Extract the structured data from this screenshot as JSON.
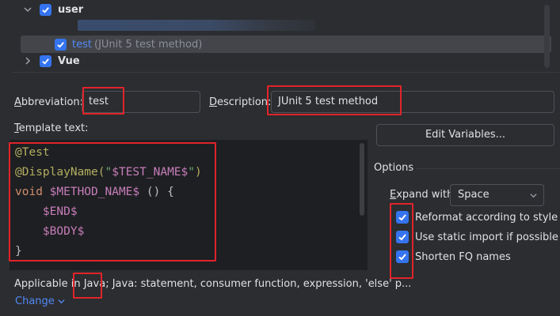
{
  "tree": {
    "items": [
      {
        "label": "user",
        "checked": true,
        "expanded": true
      },
      {
        "label": "test",
        "description": "(JUnit 5 test method)",
        "checked": true,
        "selected": true
      },
      {
        "label": "Vue",
        "checked": true,
        "expanded": false
      }
    ]
  },
  "form": {
    "abbreviation_label_u": "A",
    "abbreviation_label_rest": "bbreviation:",
    "abbreviation_value": "test",
    "description_label_u": "D",
    "description_label_rest": "escription:",
    "description_value": "JUnit 5 test method",
    "template_label_u": "T",
    "template_label_rest": "emplate text:",
    "edit_variables_label": "Edit Variables..."
  },
  "template_code": {
    "line1": "@Test",
    "line2_ann": "@DisplayName(",
    "line2_str_open": "\"",
    "line2_var": "$TEST_NAME$",
    "line2_str_close": "\"",
    "line2_end": ")",
    "line3_kw": "void ",
    "line3_var": "$METHOD_NAME$",
    "line3_rest": " () {",
    "line4_var": "$END$",
    "line5_var": "$BODY$",
    "line6": "}"
  },
  "options": {
    "title": "Options",
    "expand_with_label_u": "E",
    "expand_with_label_rest": "xpand with",
    "expand_with_value": "Space",
    "checkboxes": [
      {
        "label": "Reformat according to style",
        "checked": true
      },
      {
        "label": "Use static import if possible",
        "checked": true
      },
      {
        "label": "Shorten FQ names",
        "checked": true
      }
    ]
  },
  "applicable": {
    "prefix": "Applicable in ",
    "java": "Java",
    "rest": "; Java: statement, consumer function, expression, 'else' p...",
    "change_link": "Change"
  },
  "colors": {
    "accent": "#3574f0",
    "annotation_red": "#e0242a",
    "background": "#2b2d30",
    "editor_bg": "#1e1f22"
  }
}
